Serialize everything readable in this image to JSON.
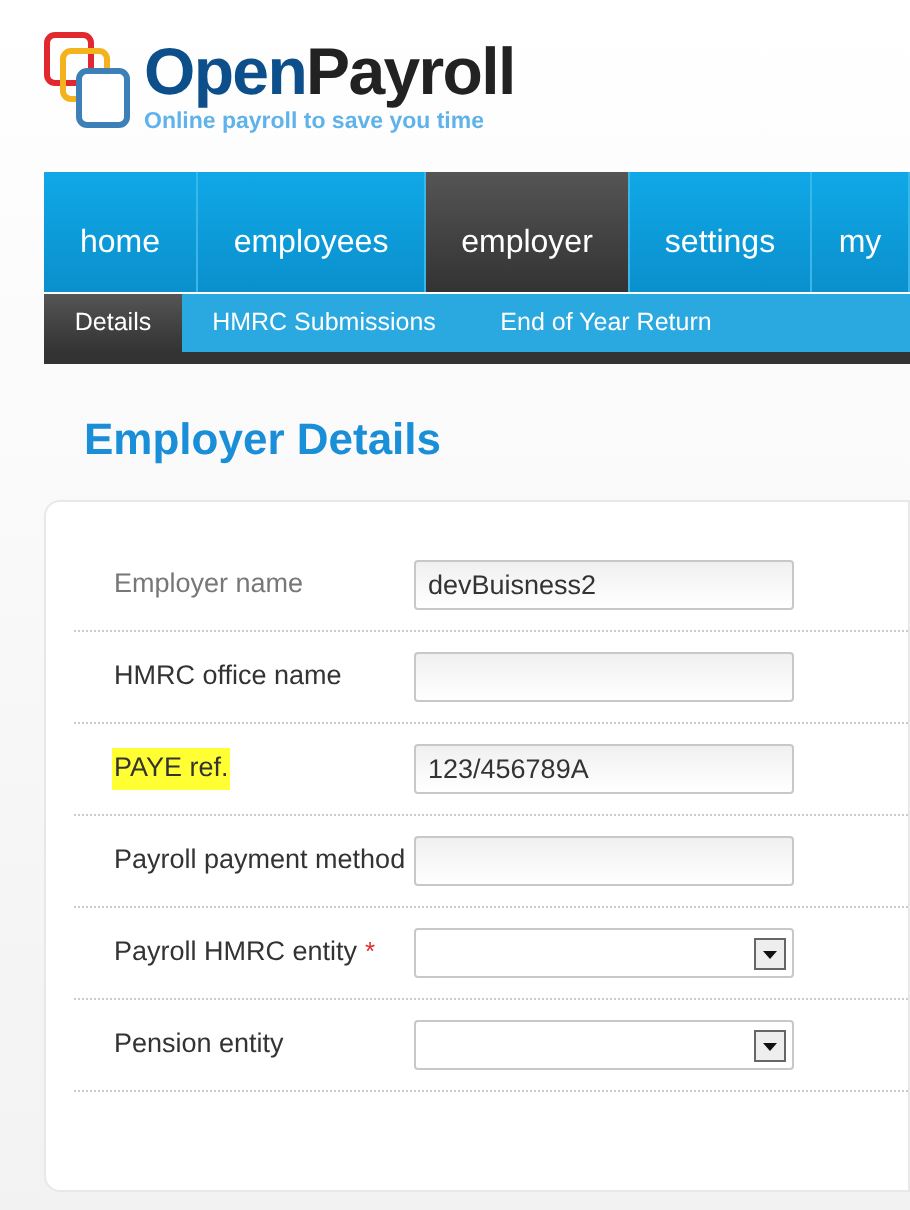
{
  "logo": {
    "name_part_1": "Open",
    "name_part_2": "Payroll",
    "tagline": "Online payroll to save you time"
  },
  "nav": [
    {
      "label": "home",
      "selected": false
    },
    {
      "label": "employees",
      "selected": false
    },
    {
      "label": "employer",
      "selected": true
    },
    {
      "label": "settings",
      "selected": false
    },
    {
      "label": "my",
      "selected": false
    }
  ],
  "subnav": [
    {
      "label": "Details",
      "selected": true
    },
    {
      "label": "HMRC Submissions",
      "selected": false
    },
    {
      "label": "End of Year Return",
      "selected": false
    }
  ],
  "heading": "Employer Details",
  "fields": [
    {
      "label": "Employer name",
      "kind": "text",
      "value": "devBuisness2",
      "highlighted": false,
      "required": false
    },
    {
      "label": "HMRC office name",
      "kind": "text",
      "highlighted": false,
      "required": false
    },
    {
      "label": "PAYE ref.",
      "kind": "text",
      "value": "123/456789A",
      "highlighted": true,
      "required": false
    },
    {
      "label": "Payroll payment method",
      "kind": "text",
      "highlighted": false,
      "required": false
    },
    {
      "label": "Payroll HMRC entity",
      "kind": "select",
      "highlighted": false,
      "required": true,
      "required_mark": "*"
    },
    {
      "label": "Pension entity",
      "kind": "select",
      "highlighted": false,
      "required": false
    }
  ]
}
